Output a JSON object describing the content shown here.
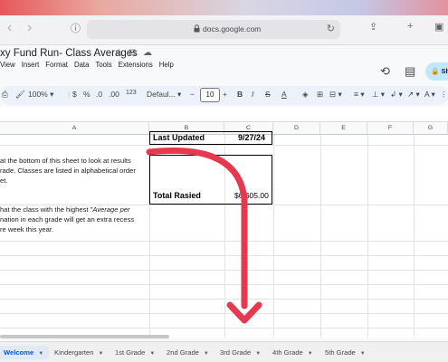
{
  "browser": {
    "url": "docs.google.com"
  },
  "doc": {
    "title": "xy Fund Run- Class Averages",
    "menu": [
      "View",
      "Insert",
      "Format",
      "Data",
      "Tools",
      "Extensions",
      "Help"
    ],
    "share_label": "Sh"
  },
  "toolbar": {
    "zoom": "100%",
    "currency": "$",
    "percent": "%",
    "decimal_dec": ".0",
    "decimal_inc": ".00",
    "number_format": "123",
    "font": "Defaul...",
    "font_size": "10"
  },
  "columns": [
    "A",
    "B",
    "C",
    "D",
    "E",
    "F",
    "G"
  ],
  "sheet": {
    "last_updated_label": "Last Updated",
    "last_updated_value": "9/27/24",
    "total_label": "Total Rasied",
    "total_value": "$6,605.00",
    "text1_line1": "at the bottom of this sheet to look at results",
    "text1_line2": "rade. Classes are listed in alphabetical order",
    "text1_line3": "et.",
    "text2_line1_a": "hat the class with the highest \"",
    "text2_line1_b": "Average per",
    "text2_line2": "nation in each grade will get an extra recess",
    "text2_line3": "re week this year."
  },
  "tabs": [
    {
      "label": "Welcome",
      "active": true
    },
    {
      "label": "Kindergarten"
    },
    {
      "label": "1st Grade"
    },
    {
      "label": "2nd Grade"
    },
    {
      "label": "3rd Grade"
    },
    {
      "label": "4th Grade"
    },
    {
      "label": "5th Grade"
    }
  ],
  "colors": {
    "annotation_arrow": "#e8384f",
    "active_tab": "#0b57d0"
  }
}
